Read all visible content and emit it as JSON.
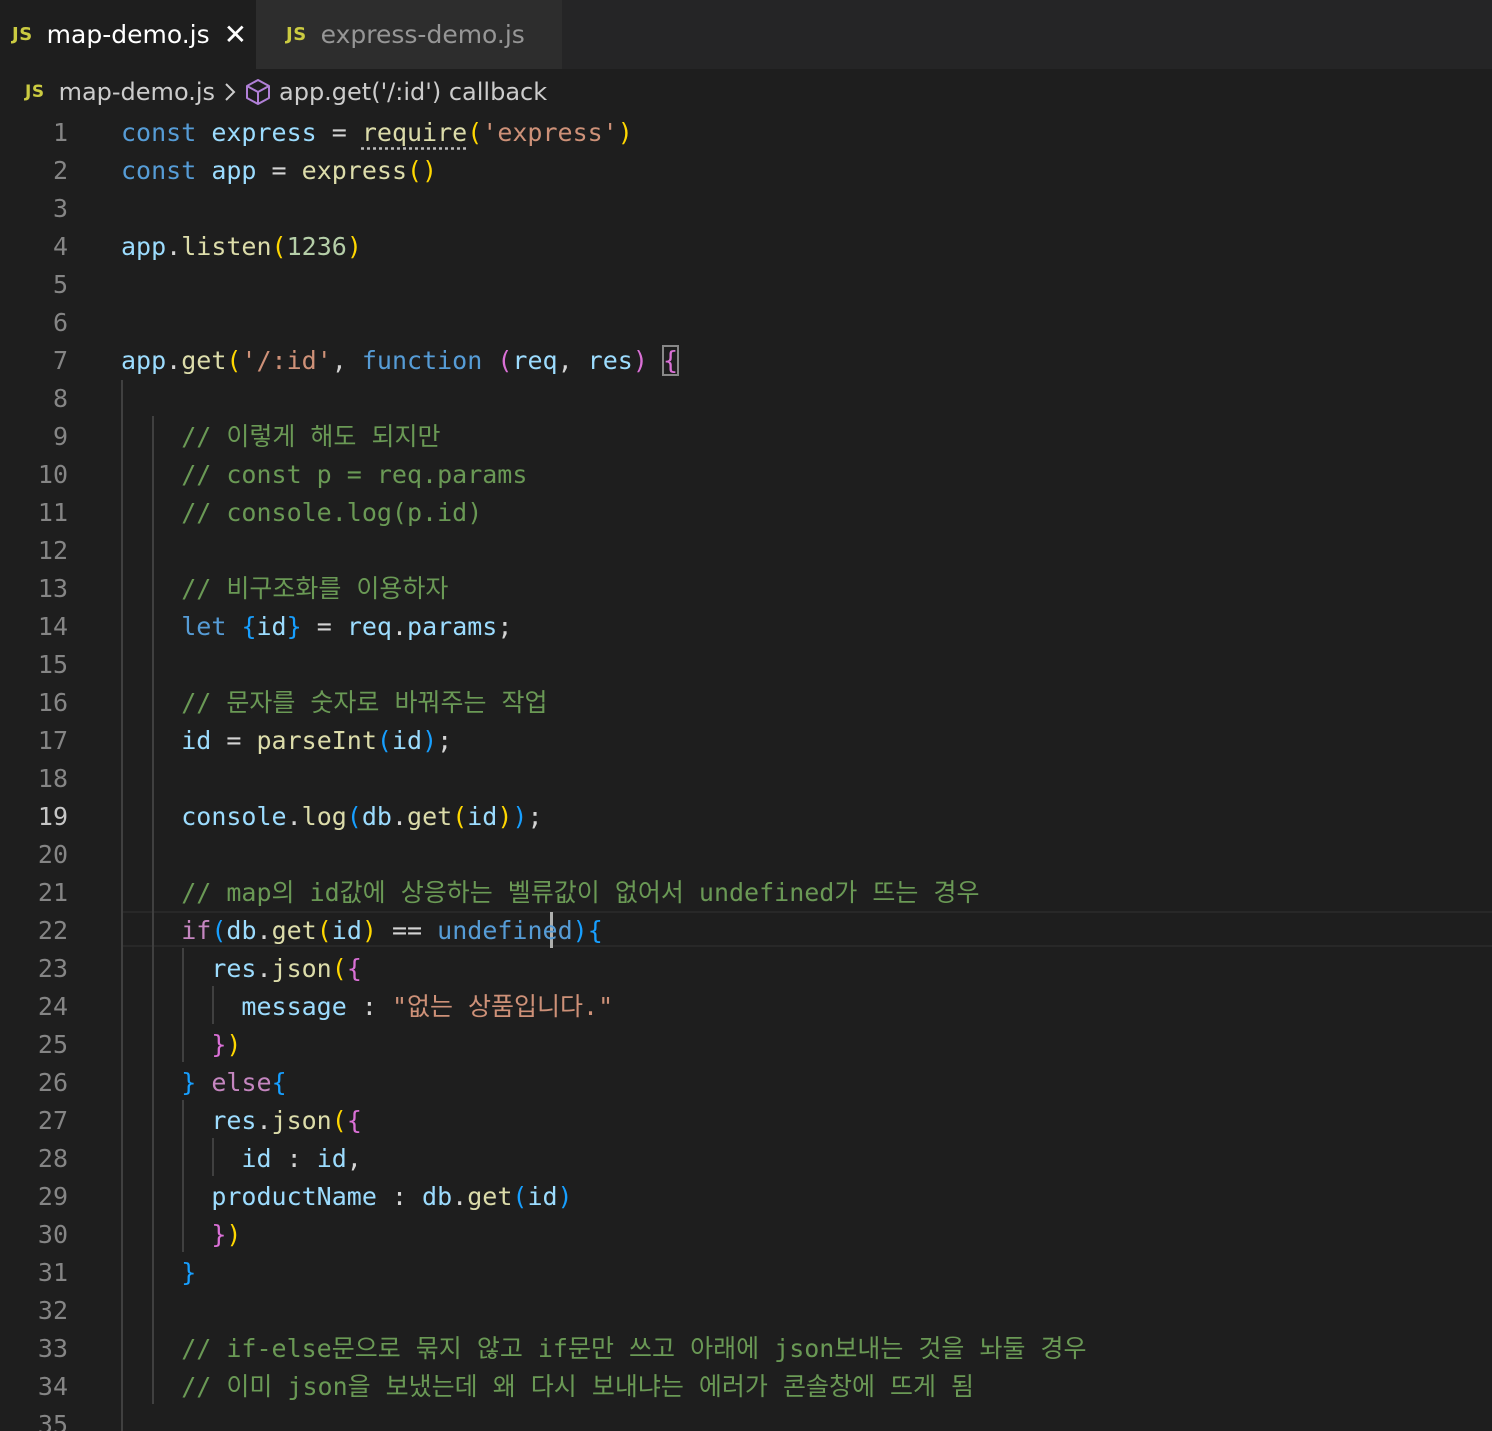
{
  "tabs": [
    {
      "label": "map-demo.js",
      "badge": "JS",
      "active": true,
      "close": "✕"
    },
    {
      "label": "express-demo.js",
      "badge": "JS",
      "active": false
    }
  ],
  "breadcrumb": {
    "badge": "JS",
    "file": "map-demo.js",
    "separator": "chevron-right-icon",
    "symbol_icon": "symbol-method-icon",
    "symbol": "app.get('/:id') callback"
  },
  "editor": {
    "current_line": 19,
    "colors": {
      "background": "#1e1e1e",
      "keyword": "#569cd6",
      "variable": "#9cdcfe",
      "function": "#dcdcaa",
      "string": "#ce9178",
      "comment": "#6a9955",
      "control": "#c586c0",
      "number": "#b5cea8"
    },
    "lines": [
      [
        [
          "kw",
          "const"
        ],
        [
          "op",
          " "
        ],
        [
          "var",
          "express"
        ],
        [
          "op",
          " = "
        ],
        [
          "fn",
          "require"
        ],
        [
          "b1",
          "("
        ],
        [
          "str",
          "'express'"
        ],
        [
          "b1",
          ")"
        ]
      ],
      [
        [
          "kw",
          "const"
        ],
        [
          "op",
          " "
        ],
        [
          "var",
          "app"
        ],
        [
          "op",
          " = "
        ],
        [
          "fn",
          "express"
        ],
        [
          "b1",
          "()"
        ]
      ],
      [],
      [
        [
          "var",
          "app"
        ],
        [
          "op",
          "."
        ],
        [
          "fn",
          "listen"
        ],
        [
          "b1",
          "("
        ],
        [
          "num",
          "1236"
        ],
        [
          "b1",
          ")"
        ]
      ],
      [],
      [],
      [
        [
          "var",
          "app"
        ],
        [
          "op",
          "."
        ],
        [
          "fn",
          "get"
        ],
        [
          "b1",
          "("
        ],
        [
          "str",
          "'/:id'"
        ],
        [
          "op",
          ", "
        ],
        [
          "kw",
          "function"
        ],
        [
          "op",
          " "
        ],
        [
          "b2",
          "("
        ],
        [
          "var",
          "req"
        ],
        [
          "op",
          ", "
        ],
        [
          "var",
          "res"
        ],
        [
          "b2",
          ")"
        ],
        [
          "op",
          " "
        ],
        [
          "b2",
          "{"
        ]
      ],
      [],
      [
        [
          "op",
          "    "
        ],
        [
          "com",
          "// 이렇게 해도 되지만"
        ]
      ],
      [
        [
          "op",
          "    "
        ],
        [
          "com",
          "// const p = req.params"
        ]
      ],
      [
        [
          "op",
          "    "
        ],
        [
          "com",
          "// console.log(p.id)"
        ]
      ],
      [],
      [
        [
          "op",
          "    "
        ],
        [
          "com",
          "// 비구조화를 이용하자"
        ]
      ],
      [
        [
          "op",
          "    "
        ],
        [
          "kw",
          "let"
        ],
        [
          "op",
          " "
        ],
        [
          "b3",
          "{"
        ],
        [
          "var",
          "id"
        ],
        [
          "b3",
          "}"
        ],
        [
          "op",
          " = "
        ],
        [
          "var",
          "req"
        ],
        [
          "op",
          "."
        ],
        [
          "var",
          "params"
        ],
        [
          "op",
          ";"
        ]
      ],
      [],
      [
        [
          "op",
          "    "
        ],
        [
          "com",
          "// 문자를 숫자로 바꿔주는 작업"
        ]
      ],
      [
        [
          "op",
          "    "
        ],
        [
          "var",
          "id"
        ],
        [
          "op",
          " = "
        ],
        [
          "fn",
          "parseInt"
        ],
        [
          "b3",
          "("
        ],
        [
          "var",
          "id"
        ],
        [
          "b3",
          ")"
        ],
        [
          "op",
          ";"
        ]
      ],
      [],
      [
        [
          "op",
          "    "
        ],
        [
          "var",
          "console"
        ],
        [
          "op",
          "."
        ],
        [
          "fn",
          "log"
        ],
        [
          "b3",
          "("
        ],
        [
          "var",
          "db"
        ],
        [
          "op",
          "."
        ],
        [
          "fn",
          "get"
        ],
        [
          "b1",
          "("
        ],
        [
          "var",
          "id"
        ],
        [
          "b1",
          ")"
        ],
        [
          "b3",
          ")"
        ],
        [
          "op",
          ";"
        ]
      ],
      [],
      [
        [
          "op",
          "    "
        ],
        [
          "com",
          "// map의 id값에 상응하는 벨류값이 없어서 undefined가 뜨는 경우"
        ]
      ],
      [
        [
          "op",
          "    "
        ],
        [
          "ctl",
          "if"
        ],
        [
          "b3",
          "("
        ],
        [
          "var",
          "db"
        ],
        [
          "op",
          "."
        ],
        [
          "fn",
          "get"
        ],
        [
          "b1",
          "("
        ],
        [
          "var",
          "id"
        ],
        [
          "b1",
          ")"
        ],
        [
          "op",
          " == "
        ],
        [
          "kw",
          "undefined"
        ],
        [
          "b3",
          ")"
        ],
        [
          "b3",
          "{"
        ]
      ],
      [
        [
          "op",
          "      "
        ],
        [
          "var",
          "res"
        ],
        [
          "op",
          "."
        ],
        [
          "fn",
          "json"
        ],
        [
          "b1",
          "("
        ],
        [
          "b2",
          "{"
        ]
      ],
      [
        [
          "op",
          "        "
        ],
        [
          "var",
          "message"
        ],
        [
          "op",
          " : "
        ],
        [
          "str",
          "\"없는 상품입니다.\""
        ]
      ],
      [
        [
          "op",
          "      "
        ],
        [
          "b2",
          "}"
        ],
        [
          "b1",
          ")"
        ]
      ],
      [
        [
          "op",
          "    "
        ],
        [
          "b3",
          "}"
        ],
        [
          "op",
          " "
        ],
        [
          "ctl",
          "else"
        ],
        [
          "b3",
          "{"
        ]
      ],
      [
        [
          "op",
          "      "
        ],
        [
          "var",
          "res"
        ],
        [
          "op",
          "."
        ],
        [
          "fn",
          "json"
        ],
        [
          "b1",
          "("
        ],
        [
          "b2",
          "{"
        ]
      ],
      [
        [
          "op",
          "        "
        ],
        [
          "var",
          "id"
        ],
        [
          "op",
          " : "
        ],
        [
          "var",
          "id"
        ],
        [
          "op",
          ","
        ]
      ],
      [
        [
          "op",
          "      "
        ],
        [
          "var",
          "productName"
        ],
        [
          "op",
          " : "
        ],
        [
          "var",
          "db"
        ],
        [
          "op",
          "."
        ],
        [
          "fn",
          "get"
        ],
        [
          "b3",
          "("
        ],
        [
          "var",
          "id"
        ],
        [
          "b3",
          ")"
        ]
      ],
      [
        [
          "op",
          "      "
        ],
        [
          "b2",
          "}"
        ],
        [
          "b1",
          ")"
        ]
      ],
      [
        [
          "op",
          "    "
        ],
        [
          "b3",
          "}"
        ]
      ],
      [],
      [
        [
          "op",
          "    "
        ],
        [
          "com",
          "// if-else문으로 묶지 않고 if문만 쓰고 아래에 json보내는 것을 놔둘 경우"
        ]
      ],
      [
        [
          "op",
          "    "
        ],
        [
          "com",
          "// 이미 json을 보냈는데 왜 다시 보내냐는 에러가 콘솔창에 뜨게 됨"
        ]
      ],
      []
    ]
  }
}
